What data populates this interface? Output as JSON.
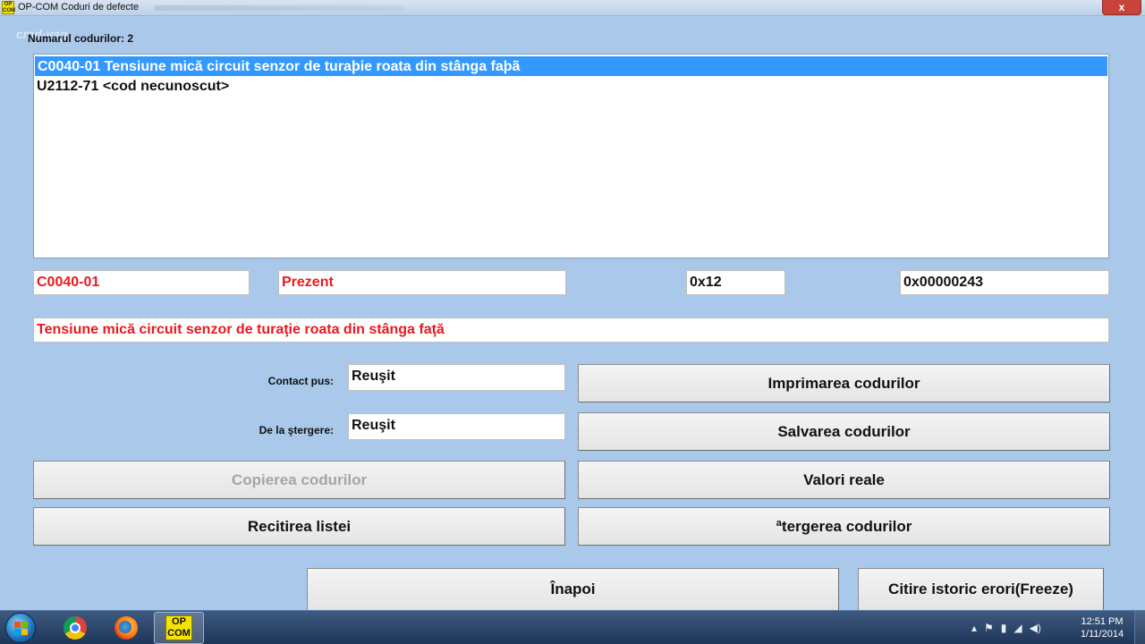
{
  "window": {
    "app_icon_text": "OP COM",
    "title": "OP-COM   Coduri de defecte",
    "close_label": "x",
    "watermark": "cmd-vag"
  },
  "header": {
    "count_label": "Numarul codurilor: 2"
  },
  "codes_list": [
    {
      "text": "C0040-01 Tensiune mică circuit senzor de turaþie roata din stânga faþã",
      "selected": true
    },
    {
      "text": "U2112-71 <cod necunoscut>",
      "selected": false
    }
  ],
  "details": {
    "code": "C0040-01",
    "status": "Prezent",
    "hex_short": "0x12",
    "hex_long": "0x00000243",
    "description": "Tensiune mică circuit senzor de turaţie roata din stânga faţă"
  },
  "contact": {
    "label": "Contact pus:",
    "value": "Reuşit"
  },
  "clear": {
    "label": "De la ştergere:",
    "value": "Reuşit"
  },
  "buttons": {
    "print": "Imprimarea codurilor",
    "save": "Salvarea codurilor",
    "copy": "Copierea codurilor",
    "real_values": "Valori reale",
    "reread": "Recitirea listei",
    "delete": "ªtergerea codurilor",
    "back": "Înapoi",
    "freeze": "Citire istoric erori(Freeze)"
  },
  "taskbar": {
    "opcom_label": "OP COM",
    "time": "12:51 PM",
    "date": "1/11/2014",
    "tray_icons": [
      "chevron-up-icon",
      "flag-icon",
      "battery-icon",
      "network-icon",
      "speaker-icon"
    ]
  },
  "colors": {
    "background": "#a9c8ea",
    "selection": "#3399ff",
    "error_text": "#e8191f"
  }
}
